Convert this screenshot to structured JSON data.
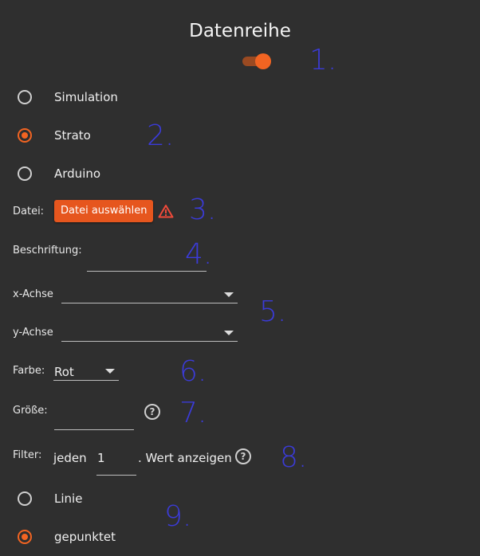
{
  "title": "Datenreihe",
  "annotations": [
    "1.",
    "2.",
    "3.",
    "4.",
    "5.",
    "6.",
    "7.",
    "8.",
    "9."
  ],
  "source": {
    "options": [
      "Simulation",
      "Strato",
      "Arduino"
    ],
    "selected": "Strato"
  },
  "file": {
    "label": "Datei:",
    "button": "Datei auswählen",
    "warning_icon": "warning-triangle-icon"
  },
  "caption": {
    "label": "Beschriftung:",
    "value": ""
  },
  "x_axis": {
    "label": "x-Achse",
    "value": ""
  },
  "y_axis": {
    "label": "y-Achse",
    "value": ""
  },
  "color": {
    "label": "Farbe:",
    "value": "Rot"
  },
  "size": {
    "label": "Größe:",
    "value": ""
  },
  "filter": {
    "label": "Filter:",
    "prefix": "jeden",
    "value": "1",
    "suffix": ". Wert anzeigen"
  },
  "style": {
    "options": [
      "Linie",
      "gepunktet"
    ],
    "selected": "gepunktet"
  },
  "colors": {
    "accent": "#f26422",
    "background": "#2f2f2f",
    "annotation": "#3b3bd8"
  }
}
